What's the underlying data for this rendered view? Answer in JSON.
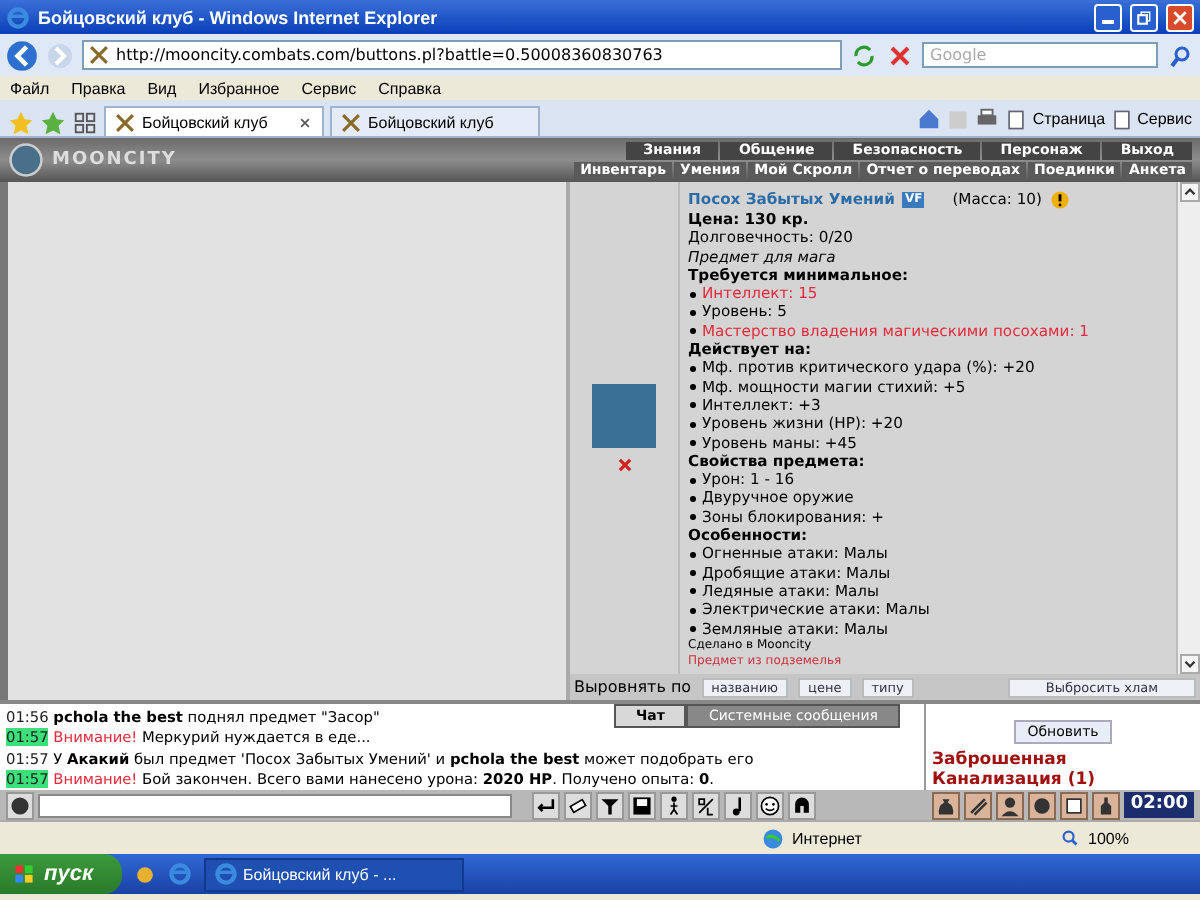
{
  "window": {
    "title": "Бойцовский клуб - Windows Internet Explorer"
  },
  "address_bar": {
    "url": "http://mooncity.combats.com/buttons.pl?battle=0.50008360830763"
  },
  "search": {
    "placeholder": "Google"
  },
  "menu": [
    "Файл",
    "Правка",
    "Вид",
    "Избранное",
    "Сервис",
    "Справка"
  ],
  "tabs": [
    {
      "label": "Бойцовский клуб",
      "selected": true
    },
    {
      "label": "Бойцовский клуб",
      "selected": false
    }
  ],
  "command_bar": [
    "Страница",
    "Сервис"
  ],
  "game_header": {
    "logo": "MOONCITY",
    "top_menu": [
      "Знания",
      "Общение",
      "Безопасность",
      "Персонаж",
      "Выход"
    ],
    "sub_menu": [
      "Инвентарь",
      "Умения",
      "Мой Скролл",
      "Отчет о переводах",
      "Поединки",
      "Анкета"
    ]
  },
  "item": {
    "name": "Посох Забытых Умений",
    "badge": "VF",
    "mass": "(Масса: 10)",
    "lines": [
      {
        "kind": "price",
        "text": "Цена: 130 кр."
      },
      {
        "kind": "plain",
        "text": "Долговечность: 0/20"
      },
      {
        "kind": "italic",
        "text": "Предмет для мага"
      },
      {
        "kind": "heading",
        "text": "Требуется минимальное:"
      },
      {
        "kind": "bullet",
        "text": "Интеллект: 15",
        "unmet": true
      },
      {
        "kind": "bullet",
        "text": "Уровень: 5",
        "unmet": false
      },
      {
        "kind": "bullet",
        "text": "Мастерство владения магическими посохами: 1",
        "unmet": true
      },
      {
        "kind": "heading",
        "text": "Действует на:"
      },
      {
        "kind": "bullet",
        "text": "Мф. против критического удара (%): +20",
        "unmet": false
      },
      {
        "kind": "bullet",
        "text": "Мф. мощности магии стихий: +5",
        "unmet": false
      },
      {
        "kind": "bullet",
        "text": "Интеллект: +3",
        "unmet": false
      },
      {
        "kind": "bullet",
        "text": "Уровень жизни (HP): +20",
        "unmet": false
      },
      {
        "kind": "bullet",
        "text": "Уровень маны: +45",
        "unmet": false
      },
      {
        "kind": "heading",
        "text": "Свойства предмета:"
      },
      {
        "kind": "bullet",
        "text": "Урон: 1 - 16",
        "unmet": false
      },
      {
        "kind": "bullet",
        "text": "Двуручное оружие",
        "unmet": false
      },
      {
        "kind": "bullet",
        "text": "Зоны блокирования: +",
        "unmet": false
      },
      {
        "kind": "heading",
        "text": "Особенности:"
      },
      {
        "kind": "bullet",
        "text": "Огненные атаки: Малы",
        "unmet": false
      },
      {
        "kind": "bullet",
        "text": "Дробящие атаки: Малы",
        "unmet": false
      },
      {
        "kind": "bullet",
        "text": "Ледяные атаки: Малы",
        "unmet": false
      },
      {
        "kind": "bullet",
        "text": "Электрические атаки: Малы",
        "unmet": false
      },
      {
        "kind": "bullet",
        "text": "Земляные атаки: Малы",
        "unmet": false
      },
      {
        "kind": "note",
        "text": "Сделано в Mooncity"
      },
      {
        "kind": "warning",
        "text": "Предмет из подземелья"
      }
    ]
  },
  "sort_bar": {
    "label": "Выровнять по",
    "buttons": [
      "названию",
      "цене",
      "типу"
    ],
    "discard_button": "Выбросить хлам"
  },
  "chat": {
    "tabs": [
      {
        "label": "Чат",
        "selected": true
      },
      {
        "label": "Системные сообщения",
        "selected": false
      }
    ],
    "messages": [
      {
        "time": "01:56",
        "highlighted": false,
        "text": "**pchola the best** поднял предмет \"Засор\""
      },
      {
        "time": "01:57",
        "highlighted": true,
        "alert": "Внимание!",
        "text": "Меркурий нуждается в еде..."
      },
      {
        "time": "01:57",
        "highlighted": false,
        "text": "У **Акакий** был предмет 'Посох Забытых Умений' и **pchola the best** может подобрать его"
      },
      {
        "time": "01:57",
        "highlighted": true,
        "alert": "Внимание!",
        "text": "Бой закончен. Всего вами нанесено урона: **2020 HP**. Получено опыта: **0**."
      }
    ]
  },
  "location_panel": {
    "refresh_button": "Обновить",
    "location": "Заброшенная Канализация",
    "count": "(1)"
  },
  "clock": "02:00",
  "status_bar": {
    "zone": "Интернет",
    "zoom": "100%"
  },
  "taskbar": {
    "start": "пуск",
    "task": "Бойцовский клуб - ..."
  }
}
